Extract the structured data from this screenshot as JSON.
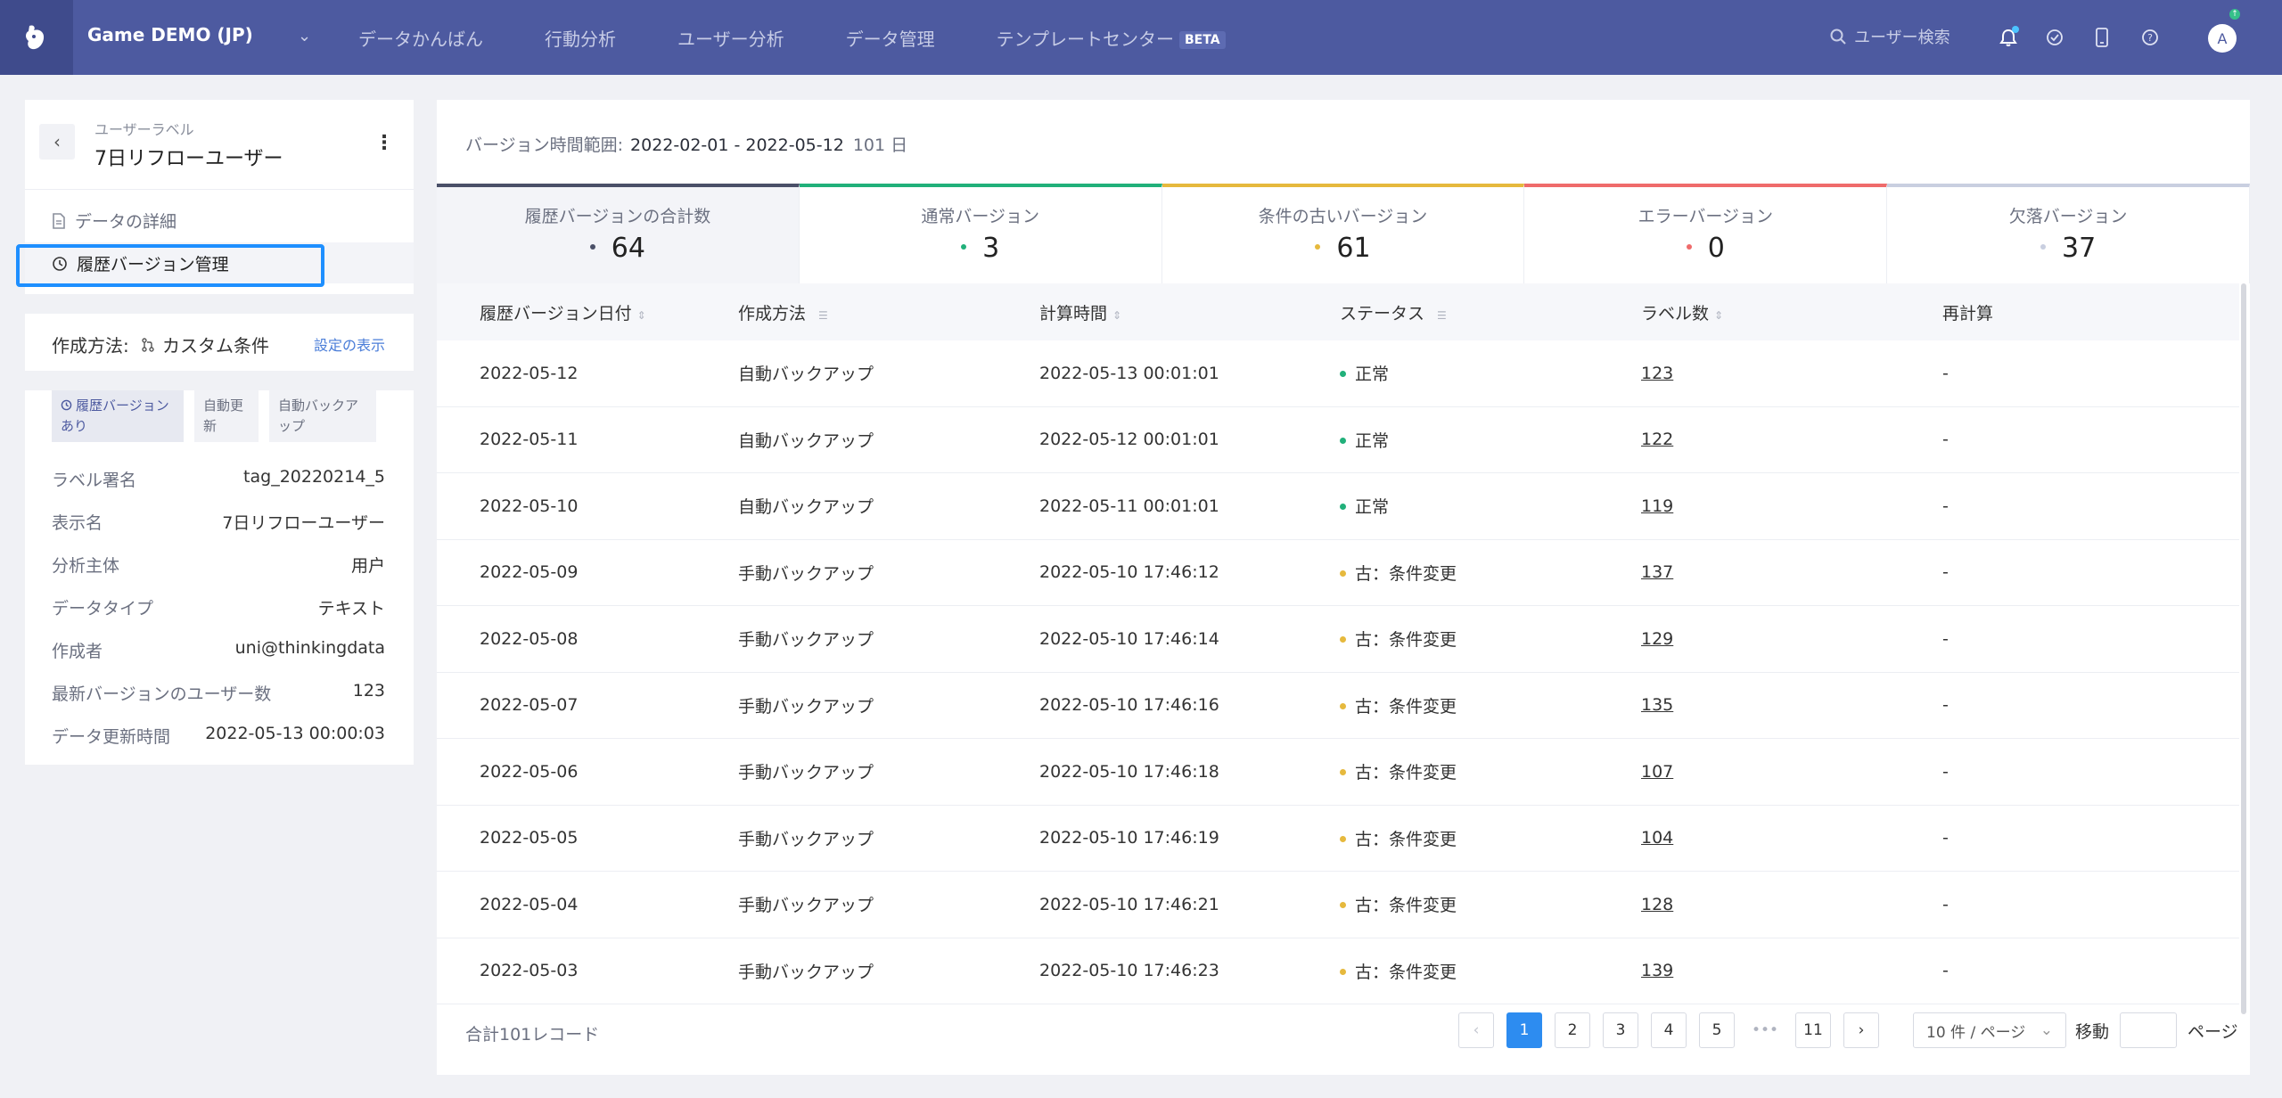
{
  "header": {
    "project": "Game DEMO (JP)",
    "nav": [
      "データかんばん",
      "行動分析",
      "ユーザー分析",
      "データ管理",
      "テンプレートセンター"
    ],
    "beta": "BETA",
    "search_placeholder": "ユーザー検索",
    "avatar": "A",
    "avatar_badge": "↑"
  },
  "sidebar": {
    "label_kind": "ユーザーラベル",
    "label_title": "7日リフローユーザー",
    "items": [
      {
        "label": "データの詳細",
        "icon": "document-icon"
      },
      {
        "label": "履歴バージョン管理",
        "icon": "history-icon"
      }
    ],
    "method_label": "作成方法:",
    "method_value": "カスタム条件",
    "method_link": "設定の表示",
    "tags": [
      "履歴バージョンあり",
      "自動更新",
      "自動バックアップ"
    ],
    "info": [
      {
        "key": "ラベル署名",
        "value": "tag_20220214_5"
      },
      {
        "key": "表示名",
        "value": "7日リフローユーザー"
      },
      {
        "key": "分析主体",
        "value": "用户"
      },
      {
        "key": "データタイプ",
        "value": "テキスト"
      },
      {
        "key": "作成者",
        "value": "uni@thinkingdata"
      },
      {
        "key": "最新バージョンのユーザー数",
        "value": "123"
      },
      {
        "key": "データ更新時間",
        "value": "2022-05-13 00:00:03"
      }
    ]
  },
  "main": {
    "range_label": "バージョン時間範囲:",
    "range_value": "2022-02-01 - 2022-05-12",
    "range_days": "101 日",
    "stats": [
      {
        "label": "履歴バージョンの合計数",
        "value": "64",
        "color": "#4a5068"
      },
      {
        "label": "通常バージョン",
        "value": "3",
        "color": "#21b07a"
      },
      {
        "label": "条件の古いバージョン",
        "value": "61",
        "color": "#e6b93d"
      },
      {
        "label": "エラーバージョン",
        "value": "0",
        "color": "#ef6b6b"
      },
      {
        "label": "欠落バージョン",
        "value": "37",
        "color": "#c9cfe0"
      }
    ],
    "columns": [
      "履歴バージョン日付",
      "作成方法",
      "計算時間",
      "ステータス",
      "ラベル数",
      "再計算"
    ],
    "rows": [
      {
        "date": "2022-05-12",
        "method": "自動バックアップ",
        "time": "2022-05-13 00:01:01",
        "status": "正常",
        "count": "123",
        "recalc": "-"
      },
      {
        "date": "2022-05-11",
        "method": "自動バックアップ",
        "time": "2022-05-12 00:01:01",
        "status": "正常",
        "count": "122",
        "recalc": "-"
      },
      {
        "date": "2022-05-10",
        "method": "自動バックアップ",
        "time": "2022-05-11 00:01:01",
        "status": "正常",
        "count": "119",
        "recalc": "-"
      },
      {
        "date": "2022-05-09",
        "method": "手動バックアップ",
        "time": "2022-05-10 17:46:12",
        "status": "古：条件変更",
        "count": "137",
        "recalc": "-"
      },
      {
        "date": "2022-05-08",
        "method": "手動バックアップ",
        "time": "2022-05-10 17:46:14",
        "status": "古：条件変更",
        "count": "129",
        "recalc": "-"
      },
      {
        "date": "2022-05-07",
        "method": "手動バックアップ",
        "time": "2022-05-10 17:46:16",
        "status": "古：条件変更",
        "count": "135",
        "recalc": "-"
      },
      {
        "date": "2022-05-06",
        "method": "手動バックアップ",
        "time": "2022-05-10 17:46:18",
        "status": "古：条件変更",
        "count": "107",
        "recalc": "-"
      },
      {
        "date": "2022-05-05",
        "method": "手動バックアップ",
        "time": "2022-05-10 17:46:19",
        "status": "古：条件変更",
        "count": "104",
        "recalc": "-"
      },
      {
        "date": "2022-05-04",
        "method": "手動バックアップ",
        "time": "2022-05-10 17:46:21",
        "status": "古：条件変更",
        "count": "128",
        "recalc": "-"
      },
      {
        "date": "2022-05-03",
        "method": "手動バックアップ",
        "time": "2022-05-10 17:46:23",
        "status": "古：条件変更",
        "count": "139",
        "recalc": "-"
      }
    ],
    "status_colors": {
      "normal": "#21b07a",
      "stale": "#e6b93d"
    },
    "total": "合計101レコード",
    "pages": [
      "1",
      "2",
      "3",
      "4",
      "5",
      "•••",
      "11"
    ],
    "page_size": "10 件 / ページ",
    "jump_label": "移動",
    "page_label": "ページ"
  }
}
